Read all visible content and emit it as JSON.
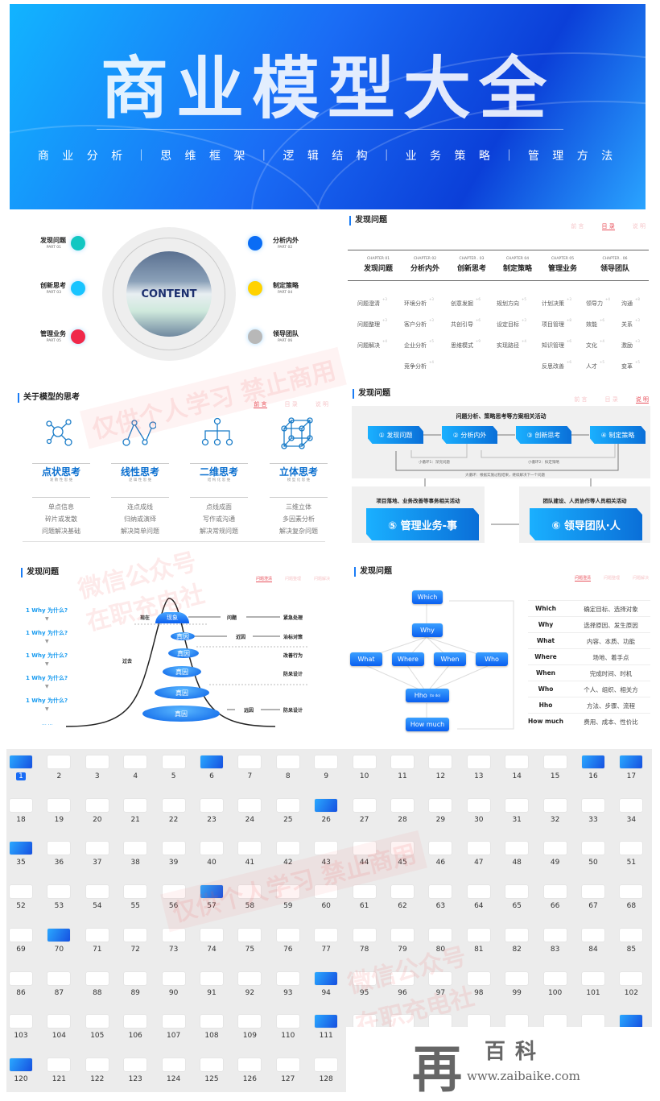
{
  "banner": {
    "title": "商业模型大全",
    "subtitle": "商 业 分 析 ｜ 思 维 框 架 ｜ 逻 辑 结 构 ｜ 业 务 策 略 ｜ 管 理 方 法"
  },
  "content_slide": {
    "center_label": "CONTENT",
    "parts": [
      {
        "name": "发现问题",
        "part": "PART 01",
        "color": "#12c7c2"
      },
      {
        "name": "分析内外",
        "part": "PART 02",
        "color": "#0a6cf5"
      },
      {
        "name": "创新思考",
        "part": "PART 03",
        "color": "#18c4ff"
      },
      {
        "name": "制定策略",
        "part": "PART 04",
        "color": "#ffd200"
      },
      {
        "name": "管理业务",
        "part": "PART 05",
        "color": "#f0284a"
      },
      {
        "name": "领导团队",
        "part": "PART 06",
        "color": "#b8b8b8"
      }
    ]
  },
  "toc_slide": {
    "title": "发现问题",
    "tabs": [
      "前 言",
      "目 录",
      "说 明"
    ],
    "active_tab": 1,
    "chapters": [
      {
        "chapter": "CHAPTER 01",
        "name": "发现问题",
        "items": [
          [
            "问题澄清",
            "+3"
          ],
          [
            "问题整理",
            "+3"
          ],
          [
            "问题解决",
            "+4"
          ]
        ]
      },
      {
        "chapter": "CHAPTER 02",
        "name": "分析内外",
        "items": [
          [
            "环境分析",
            "+3"
          ],
          [
            "客户分析",
            "+3"
          ],
          [
            "企业分析",
            "+5"
          ],
          [
            "竞争分析",
            "+4"
          ]
        ]
      },
      {
        "chapter": "CHAPTER . 03",
        "name": "创新思考",
        "items": [
          [
            "创意发掘",
            "+6"
          ],
          [
            "共创引导",
            "+6"
          ],
          [
            "思维模式",
            "+9"
          ]
        ]
      },
      {
        "chapter": "CHAPTER 04",
        "name": "制定策略",
        "items": [
          [
            "规划方向",
            "+5"
          ],
          [
            "设定目标",
            "+3"
          ],
          [
            "实现路径",
            "+4"
          ]
        ]
      },
      {
        "chapter": "CHAPTER 05",
        "name": "管理业务",
        "items": [
          [
            "计划决策",
            "+3"
          ],
          [
            "项目管理",
            "+8"
          ],
          [
            "知识管理",
            "+6"
          ],
          [
            "反思改善",
            "+6"
          ]
        ]
      },
      {
        "chapter": "CHAPTER . 06",
        "name": "领导团队",
        "items": [
          [
            "领导力",
            "+4"
          ],
          [
            "沟通",
            "+8"
          ],
          [
            "效能",
            "+6"
          ],
          [
            "关系",
            "+3"
          ],
          [
            "文化",
            "+4"
          ],
          [
            "激励",
            "+3"
          ],
          [
            "人才",
            "+5"
          ],
          [
            "变革",
            "+5"
          ]
        ]
      }
    ]
  },
  "thinking_slide": {
    "title": "关于模型的思考",
    "tabs": [
      "前 言",
      "目 录",
      "说 明"
    ],
    "active_tab": 0,
    "columns": [
      {
        "icon": "point-network-icon",
        "name": "点状思考",
        "sub": "发 散 性 思 维",
        "items": [
          "单点信息",
          "碎片或发散",
          "问题解决基础"
        ]
      },
      {
        "icon": "line-network-icon",
        "name": "线性思考",
        "sub": "逻 辑 性 思 维",
        "items": [
          "连点成线",
          "归纳或演绎",
          "解决简单问题"
        ]
      },
      {
        "icon": "tree-structure-icon",
        "name": "二维思考",
        "sub": "结 构 化 思 维",
        "items": [
          "点线成面",
          "写作或沟通",
          "解决常规问题"
        ]
      },
      {
        "icon": "cube-network-icon",
        "name": "立体思考",
        "sub": "模 型 化 思 维",
        "items": [
          "三维立体",
          "多因素分析",
          "解决复杂问题"
        ]
      }
    ]
  },
  "flow_slide": {
    "title": "发现问题",
    "tabs": [
      "前 言",
      "目 录",
      "说 明"
    ],
    "active_tab": 2,
    "top_heading": "问题分析、策略思考等方案相关活动",
    "steps": [
      "① 发现问题",
      "② 分析内外",
      "③ 创新思考",
      "④ 制定策略"
    ],
    "loop1": "小循环1：深究问题",
    "loop2": "小循环2：拟定策略",
    "big_loop": "大循环：根据实施过程结果，继续解决下一个问题",
    "left_heading": "项目落地、业务改善等事务相关活动",
    "left_box": "⑤ 管理业务-事",
    "right_heading": "团队建设、人员协作等人员相关活动",
    "right_box": "⑥ 领导团队·人"
  },
  "why_slide": {
    "title": "发现问题",
    "tabs": [
      "问题澄清",
      "问题整理",
      "问题解决"
    ],
    "active_tab": 0,
    "whys": [
      "1  Why 为什么?",
      "1  Why 为什么?",
      "1  Why 为什么?",
      "1  Why 为什么?",
      "1  Why 为什么?"
    ],
    "more": "... ...",
    "now": "现在",
    "past": "过去",
    "layers": [
      "现象",
      "真因",
      "真因",
      "真因",
      "真因",
      "真因"
    ],
    "right": {
      "problem": "问题",
      "urgent": "紧急处理",
      "near": "近因",
      "symptom": "治标对策",
      "improve": "改善行为",
      "proof1": "防呆设计",
      "far": "远因",
      "proof2": "防呆设计"
    }
  },
  "w5h2_slide": {
    "title": "发现问题",
    "tabs": [
      "问题澄清",
      "问题整理",
      "问题解决"
    ],
    "active_tab": 0,
    "nodes": {
      "which": "Which",
      "why": "Why",
      "what": "What",
      "where": "Where",
      "when": "When",
      "who": "Who",
      "hho": "Hho",
      "hho_note": "(to do)",
      "howmuch": "How  much"
    },
    "table": [
      [
        "Which",
        "确定目标、选择对象"
      ],
      [
        "Why",
        "选择原因、发生原因"
      ],
      [
        "What",
        "内容、本质、功能"
      ],
      [
        "Where",
        "场地、着手点"
      ],
      [
        "When",
        "完成时间、时机"
      ],
      [
        "Who",
        "个人、组织、相关方"
      ],
      [
        "Hho",
        "方法、步骤、流程"
      ],
      [
        "How much",
        "费用、成本、性价比"
      ]
    ]
  },
  "thumbnails": {
    "count": 128,
    "selected": 1,
    "blue": [
      1,
      6,
      16,
      17,
      26,
      35,
      57,
      70,
      94,
      111,
      119,
      120
    ]
  },
  "watermarks": [
    "仅供个人学习 禁止商用",
    "微信公众号",
    "在职充电社"
  ],
  "logo": {
    "mark": "再",
    "name": "百科",
    "url": "www.zaibaike.com"
  }
}
